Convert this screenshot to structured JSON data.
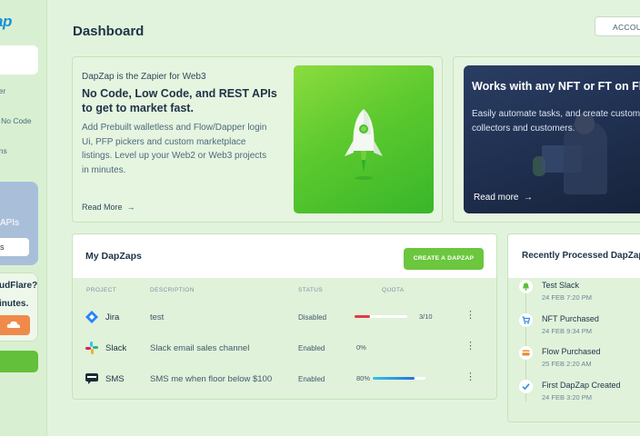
{
  "sidebar": {
    "logo": "ap",
    "links": [
      "der",
      "d No Code",
      "ons"
    ],
    "promo_card": {
      "title": "APIs",
      "button": "s"
    },
    "cloudflare_card": {
      "line1": "udFlare?",
      "line2": "inutes."
    }
  },
  "header": {
    "title": "Dashboard",
    "account_label": "ACCOU"
  },
  "hero": {
    "kicker": "DapZap is the Zapier for Web3",
    "headline": "No Code, Low Code, and REST APIs to get to market fast.",
    "body": "Add Prebuilt walletless and Flow/Dapper login Ui, PFP pickers and custom marketplace listings. Level up your Web2 or Web3 projects in minutes.",
    "read_more": "Read More"
  },
  "nft_card": {
    "title": "Works with any NFT or FT on Flo",
    "desc_line1": "Easily automate tasks, and create custom",
    "desc_line2": "collectors and customers.",
    "read_more": "Read more"
  },
  "dapzaps": {
    "title": "My DapZaps",
    "create_button": "CREATE A DAPZAP",
    "columns": {
      "project": "PROJECT",
      "description": "DESCRIPTION",
      "status": "STATUS",
      "quota": "QUOTA"
    },
    "rows": [
      {
        "name": "Jira",
        "description": "test",
        "status": "Disabled",
        "quota_fraction": 0.3,
        "quota_text": "3/10",
        "pct_text": "",
        "bar_color": "#e5374a"
      },
      {
        "name": "Slack",
        "description": "Slack email sales channel",
        "status": "Enabled",
        "quota_fraction": 0,
        "quota_text": "",
        "pct_text": "0%",
        "bar_color": "#2a9ee6"
      },
      {
        "name": "SMS",
        "description": "SMS me when floor below $100",
        "status": "Enabled",
        "quota_fraction": 0.8,
        "quota_text": "",
        "pct_text": "80%",
        "bar_color": "#2a9ee6"
      }
    ]
  },
  "recent": {
    "title": "Recently Processed DapZaps",
    "events": [
      {
        "name": "Test Slack",
        "time": "24 FEB 7:20 PM",
        "icon": "bell-icon",
        "color": "#5cbf3a"
      },
      {
        "name": "NFT Purchased",
        "time": "24 FEB 9:34 PM",
        "icon": "cart-icon",
        "color": "#2a8fe0"
      },
      {
        "name": "Flow Purchased",
        "time": "25 FEB 2:20 AM",
        "icon": "card-icon",
        "color": "#f08a2a"
      },
      {
        "name": "First DapZap Created",
        "time": "24 FEB 3:20 PM",
        "icon": "check-icon",
        "color": "#2a8fe0"
      }
    ]
  }
}
